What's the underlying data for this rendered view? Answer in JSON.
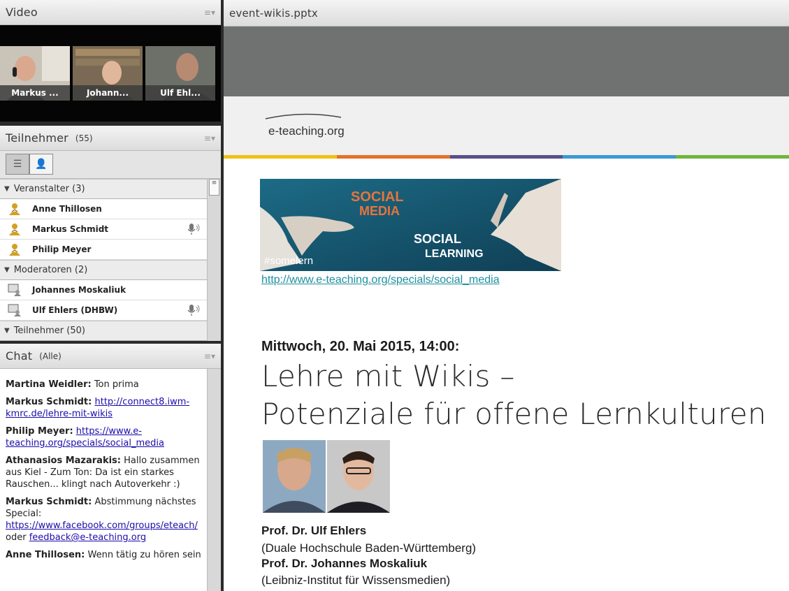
{
  "video": {
    "title": "Video",
    "feeds": [
      {
        "label": "Markus ..."
      },
      {
        "label": "Johann..."
      },
      {
        "label": "Ulf Ehl..."
      }
    ]
  },
  "participants": {
    "title": "Teilnehmer",
    "count": "(55)",
    "groups": [
      {
        "label": "Veranstalter (3)",
        "members": [
          {
            "name": "Anne Thillosen",
            "speaking": false
          },
          {
            "name": "Markus Schmidt",
            "speaking": true
          },
          {
            "name": "Philip Meyer",
            "speaking": false
          }
        ]
      },
      {
        "label": "Moderatoren (2)",
        "members": [
          {
            "name": "Johannes Moskaliuk",
            "speaking": false
          },
          {
            "name": "Ulf Ehlers (DHBW)",
            "speaking": true
          }
        ]
      },
      {
        "label": "Teilnehmer (50)",
        "members": []
      }
    ]
  },
  "chat": {
    "title": "Chat",
    "scope": "(Alle)",
    "messages": [
      {
        "who": "Martina Weidler:",
        "text": "Ton prima",
        "link": "",
        "text2": "",
        "link2": ""
      },
      {
        "who": "Markus Schmidt:",
        "text": "",
        "link": "http://connect8.iwm-kmrc.de/lehre-mit-wikis",
        "text2": "",
        "link2": ""
      },
      {
        "who": "Philip Meyer:",
        "text": "",
        "link": "https://www.e-teaching.org/specials/social_media",
        "text2": "",
        "link2": ""
      },
      {
        "who": "Athanasios Mazarakis:",
        "text": "Hallo zusammen aus Kiel - Zum Ton: Da ist ein starkes Rauschen... klingt nach Autoverkehr :)",
        "link": "",
        "text2": "",
        "link2": ""
      },
      {
        "who": "Markus Schmidt:",
        "text": "Abstimmung nächstes Special:",
        "link": "https://www.facebook.com/groups/eteach/",
        "text2": "oder",
        "link2": "feedback@e-teaching.org"
      },
      {
        "who": "Anne Thillosen:",
        "text": "Wenn tätig zu hören sein",
        "link": "",
        "text2": "",
        "link2": ""
      }
    ]
  },
  "share": {
    "filename": "event-wikis.pptx",
    "brand": "e-teaching.org",
    "banner": {
      "tag": "#somelern",
      "word1": "SOCIAL MEDIA",
      "word2": "SOCIAL LEARNING"
    },
    "link": "http://www.e-teaching.org/specials/social_media",
    "date": "Mittwoch, 20. Mai 2015, 14:00:",
    "title_line1": "Lehre mit Wikis –",
    "title_line2": "Potenziale für offene Lernkulturen",
    "speakers": [
      {
        "name": "Prof. Dr. Ulf Ehlers",
        "affil": "(Duale Hochschule Baden-Württemberg)"
      },
      {
        "name": "Prof. Dr. Johannes Moskaliuk",
        "affil": "(Leibniz-Institut für Wissensmedien)"
      }
    ],
    "stripe_colors": [
      "#f2c012",
      "#e5712a",
      "#5a4e8c",
      "#3b9ad2",
      "#6fb63d"
    ]
  }
}
